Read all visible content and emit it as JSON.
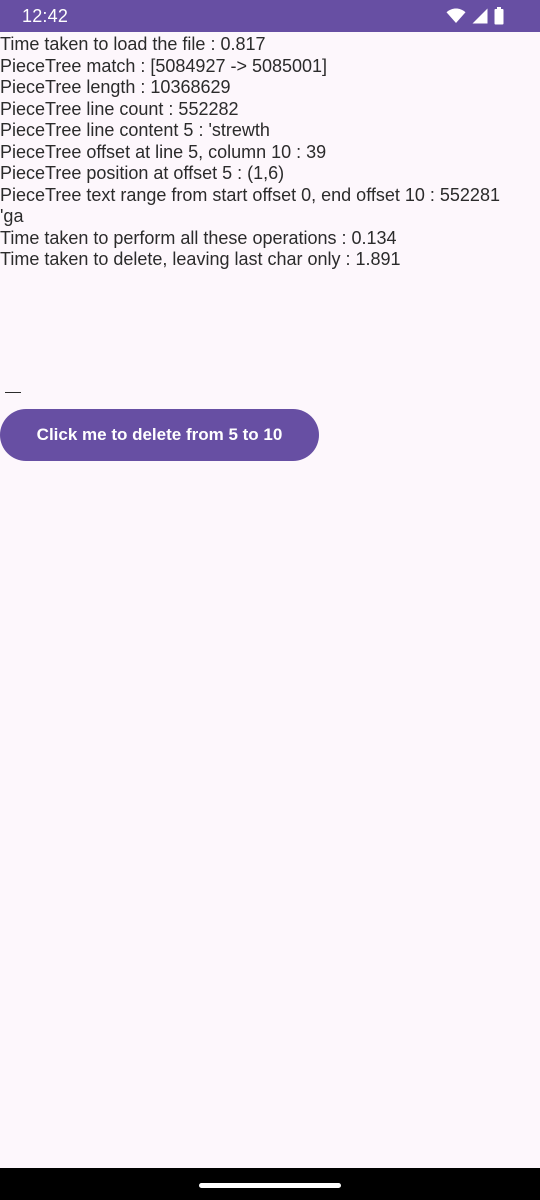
{
  "status_bar": {
    "time": "12:42",
    "icons": [
      "wifi-icon",
      "signal-icon",
      "battery-icon"
    ],
    "color": "#674fa3"
  },
  "output_lines": [
    "Time taken to load the file : 0.817",
    "PieceTree match : [5084927 -> 5085001]",
    "PieceTree length : 10368629",
    "PieceTree line count : 552282",
    "PieceTree line content 5 : 'strewth",
    "PieceTree offset at line 5, column 10 : 39",
    "PieceTree position at offset 5 : (1,6)",
    "PieceTree text range from start offset 0, end offset 10 : 552281",
    "'ga",
    "Time taken to perform all these operations : 0.134",
    "Time taken to delete, leaving last char only : 1.891"
  ],
  "button": {
    "label": "Click me to delete from 5 to 10",
    "color": "#674fa3"
  },
  "background_color": "#fdf7fc"
}
